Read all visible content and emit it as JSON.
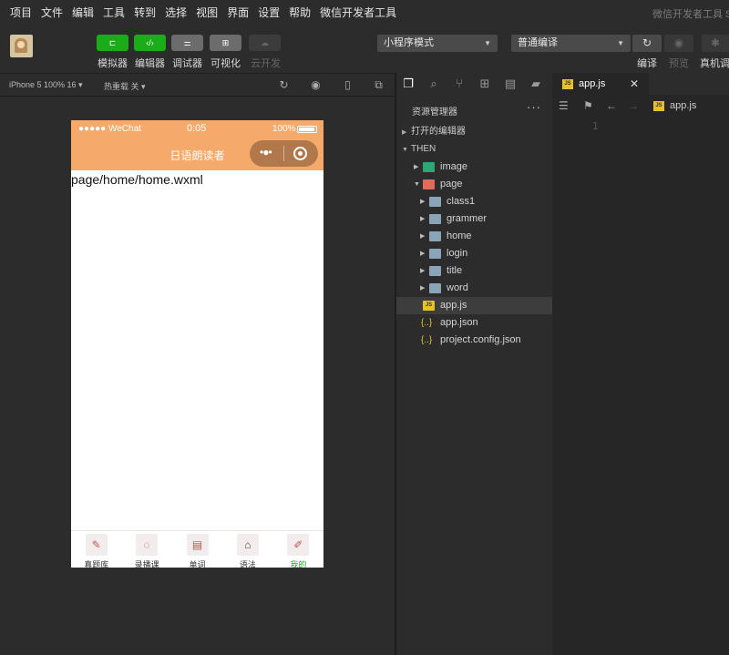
{
  "menu": [
    "项目",
    "文件",
    "编辑",
    "工具",
    "转到",
    "选择",
    "视图",
    "界面",
    "设置",
    "帮助",
    "微信开发者工具"
  ],
  "app_title": "微信开发者工具 St",
  "toolbar": {
    "simulator_label": "模拟器",
    "editor_label": "编辑器",
    "debugger_label": "调试器",
    "visual_label": "可视化",
    "cloud_label": "云开发",
    "mode_select": "小程序模式",
    "compile_select": "普通编译",
    "compile_label": "编译",
    "preview_label": "预览",
    "realdevice_label": "真机调"
  },
  "simbar": {
    "device": "iPhone 5 100% 16 ▾",
    "hotreload": "热重载 关 ▾"
  },
  "phone": {
    "carrier": "●●●●● WeChat",
    "time": "0:05",
    "battery": "100%",
    "nav_title": "日语朗读者",
    "capsule_dots": "•●•",
    "page_text": "page/home/home.wxml",
    "tabs": [
      {
        "label": "真题库",
        "icon": "✎"
      },
      {
        "label": "录播课",
        "icon": "◌"
      },
      {
        "label": "单词",
        "icon": "▤"
      },
      {
        "label": "语法",
        "icon": "⌂"
      },
      {
        "label": "我的",
        "icon": "✐"
      }
    ]
  },
  "explorer": {
    "title": "资源管理器",
    "more": "···",
    "open_editors": "打开的编辑器",
    "project": "THEN",
    "tree": [
      {
        "label": "image",
        "type": "folder-img"
      },
      {
        "label": "page",
        "type": "folder-page"
      },
      {
        "label": "class1",
        "type": "folder"
      },
      {
        "label": "grammer",
        "type": "folder"
      },
      {
        "label": "home",
        "type": "folder"
      },
      {
        "label": "login",
        "type": "folder"
      },
      {
        "label": "title",
        "type": "folder"
      },
      {
        "label": "word",
        "type": "folder"
      },
      {
        "label": "app.js",
        "type": "js"
      },
      {
        "label": "app.json",
        "type": "json"
      },
      {
        "label": "project.config.json",
        "type": "json"
      }
    ]
  },
  "editor": {
    "tab_name": "app.js",
    "close": "✕",
    "crumb": "app.js",
    "line1": "1",
    "js_badge": "JS",
    "json_badge": "{..}"
  },
  "colors": {
    "accent_green": "#1aad19",
    "nav_orange": "#f5aa6c",
    "bg_dark": "#2c2c2c"
  }
}
